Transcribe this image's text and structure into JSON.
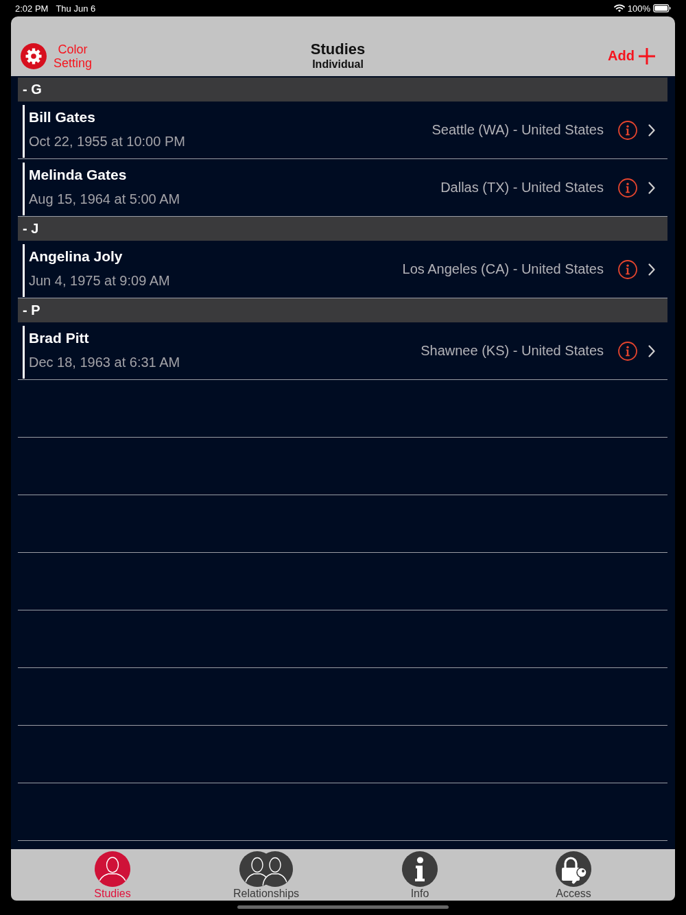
{
  "status_bar": {
    "time": "2:02 PM",
    "date": "Thu Jun 6",
    "battery": "100%"
  },
  "nav_bar": {
    "left_button": "Color Setting",
    "title": "Studies",
    "subtitle": "Individual",
    "right_button": "Add"
  },
  "sections": [
    {
      "header": "- G",
      "rows": [
        {
          "name": "Bill Gates",
          "date": "Oct 22, 1955 at 10:00 PM",
          "place": "Seattle (WA) - United States"
        },
        {
          "name": "Melinda Gates",
          "date": "Aug 15, 1964 at 5:00 AM",
          "place": "Dallas (TX) - United States"
        }
      ]
    },
    {
      "header": "- J",
      "rows": [
        {
          "name": "Angelina Joly",
          "date": "Jun 4, 1975 at 9:09 AM",
          "place": "Los Angeles (CA) - United States"
        }
      ]
    },
    {
      "header": "- P",
      "rows": [
        {
          "name": "Brad Pitt",
          "date": "Dec 18, 1963 at 6:31 AM",
          "place": "Shawnee (KS) - United States"
        }
      ]
    }
  ],
  "tabs": [
    {
      "label": "Studies",
      "kind": "person",
      "selected": true
    },
    {
      "label": "Relationships",
      "kind": "pair",
      "selected": false
    },
    {
      "label": "Info",
      "kind": "info",
      "selected": false
    },
    {
      "label": "Access",
      "kind": "lock",
      "selected": false
    }
  ]
}
